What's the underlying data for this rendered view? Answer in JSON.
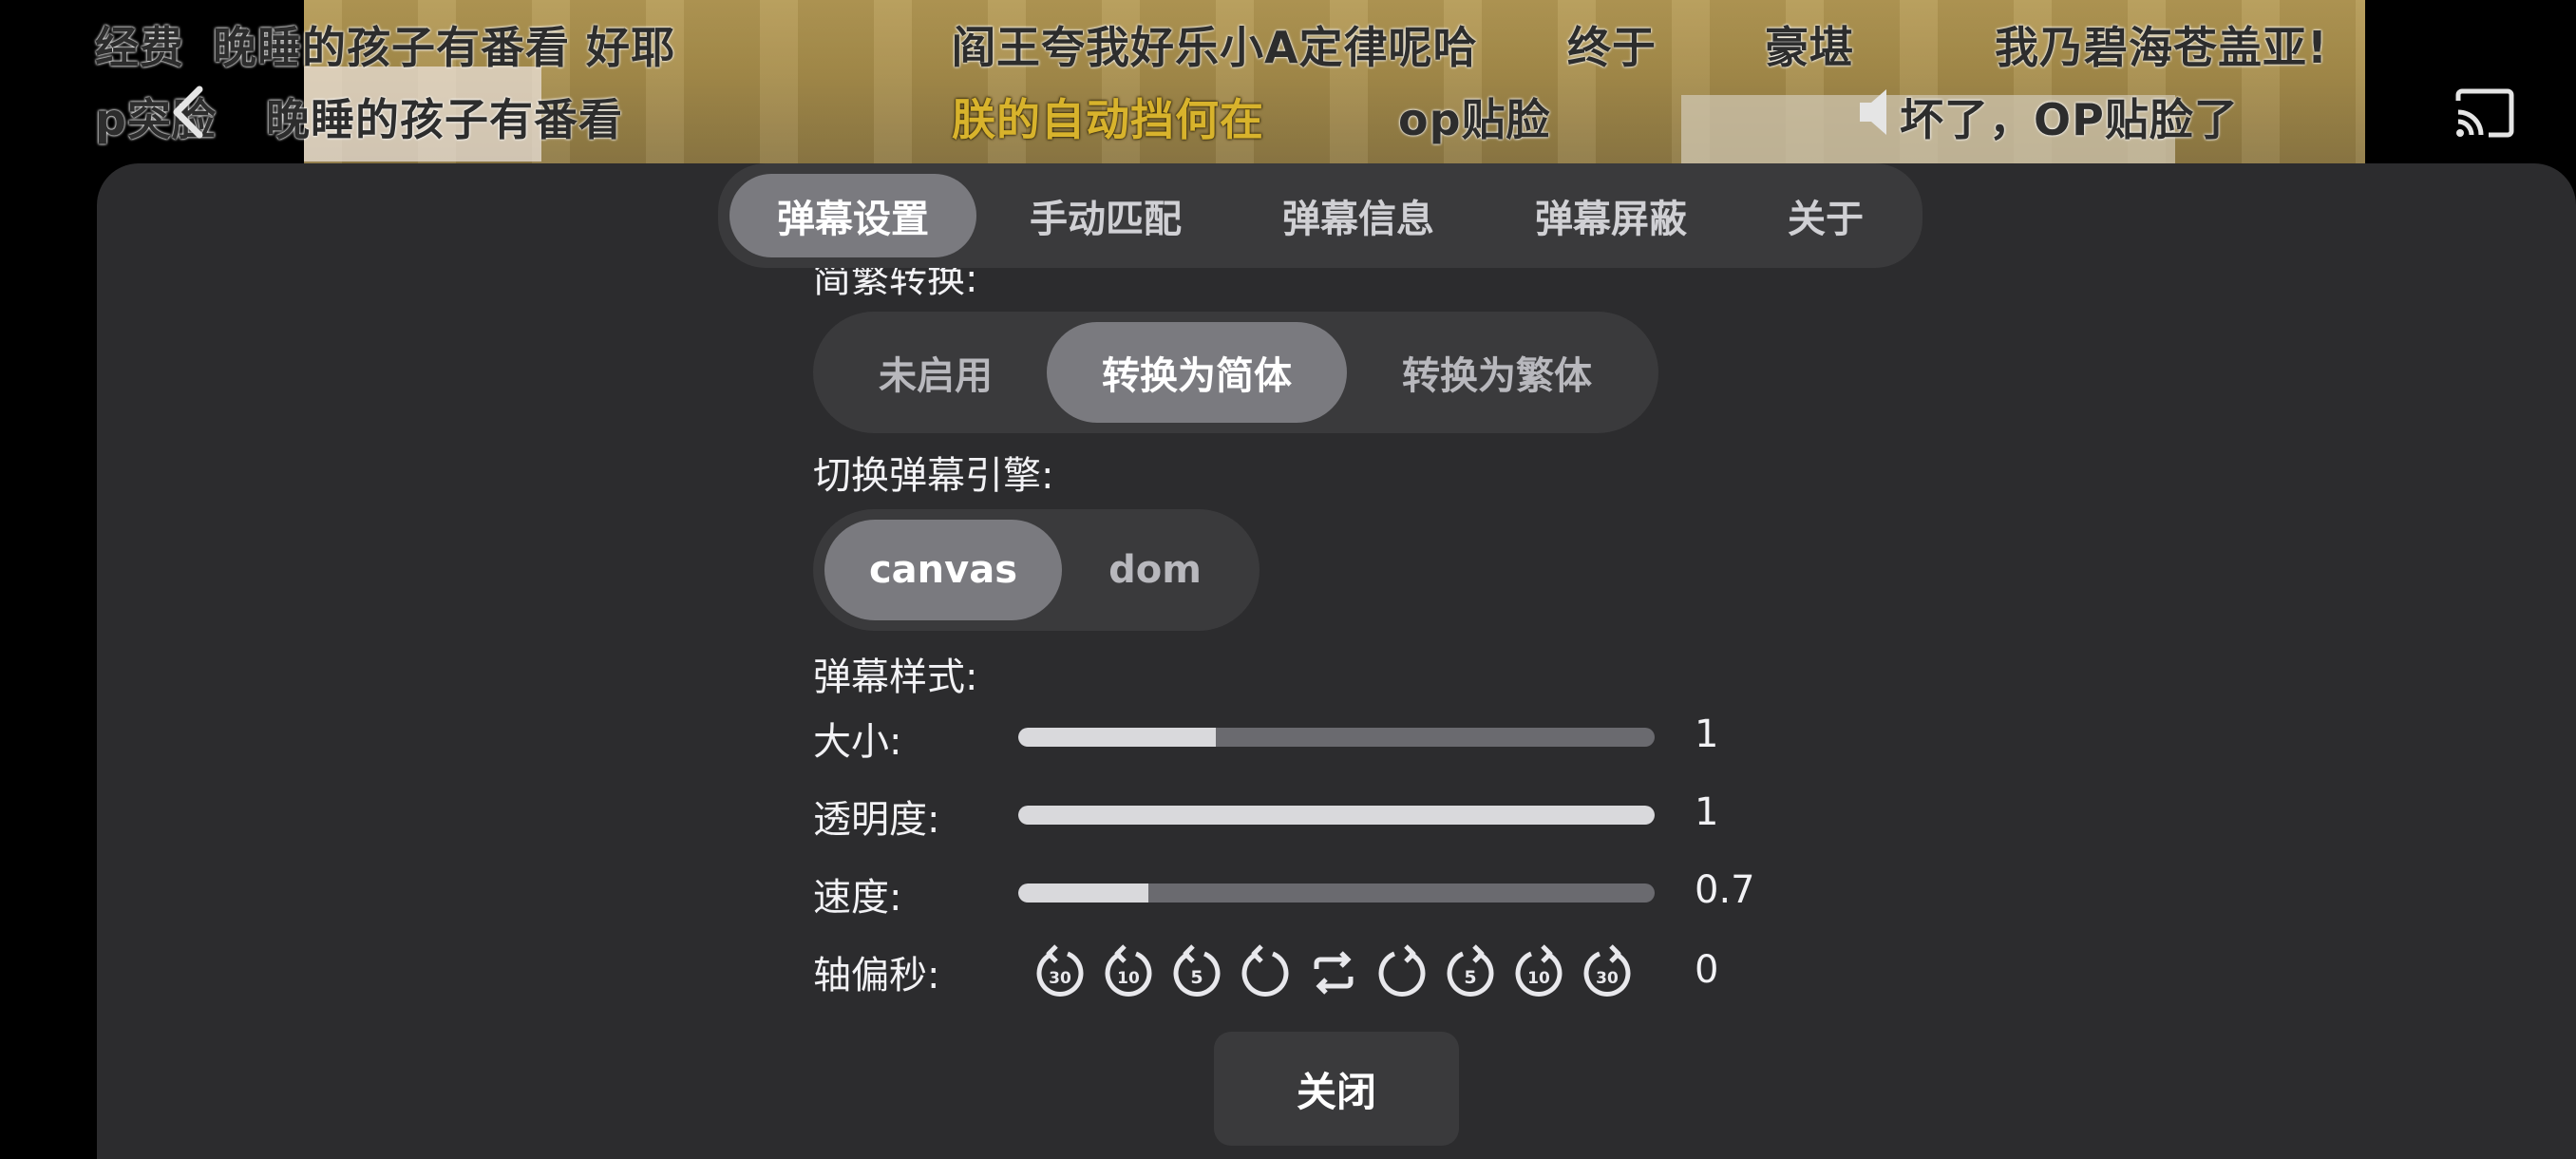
{
  "video": {
    "danmaku_row1": [
      "经费",
      "晚睡的孩子有番看 好耶",
      "阎王夸我好乐小A定律呢哈",
      "终于",
      "豪堪",
      "我乃碧海苍盖亚!"
    ],
    "danmaku_row2": [
      "p突脸",
      "晚睡的孩子有番看",
      "朕的自动挡何在",
      "op贴脸",
      "坏了，OP贴脸了"
    ]
  },
  "tabs": [
    {
      "label": "弹幕设置",
      "active": true
    },
    {
      "label": "手动匹配",
      "active": false
    },
    {
      "label": "弹幕信息",
      "active": false
    },
    {
      "label": "弹幕屏蔽",
      "active": false
    },
    {
      "label": "关于",
      "active": false
    }
  ],
  "settings": {
    "convert_label": "简繁转换:",
    "convert_options": [
      {
        "label": "未启用",
        "active": false
      },
      {
        "label": "转换为简体",
        "active": true
      },
      {
        "label": "转换为繁体",
        "active": false
      }
    ],
    "engine_label": "切换弹幕引擎:",
    "engine_options": [
      {
        "label": "canvas",
        "active": true
      },
      {
        "label": "dom",
        "active": false
      }
    ],
    "style_label": "弹幕样式:",
    "size": {
      "label": "大小:",
      "value_text": "1",
      "fill_fraction": 0.31
    },
    "opacity": {
      "label": "透明度:",
      "value_text": "1",
      "fill_fraction": 1.0
    },
    "speed": {
      "label": "速度:",
      "value_text": "0.7",
      "fill_fraction": 0.205
    },
    "offset": {
      "label": "轴偏秒:",
      "value_text": "0",
      "buttons": [
        {
          "icon": "rewind-30-icon",
          "num": "30",
          "dir": "back"
        },
        {
          "icon": "rewind-10-icon",
          "num": "10",
          "dir": "back"
        },
        {
          "icon": "rewind-5-icon",
          "num": "5",
          "dir": "back"
        },
        {
          "icon": "rewind-1-icon",
          "num": "",
          "dir": "back"
        },
        {
          "icon": "reset-icon",
          "num": "",
          "dir": "reset"
        },
        {
          "icon": "forward-1-icon",
          "num": "",
          "dir": "fwd"
        },
        {
          "icon": "forward-5-icon",
          "num": "5",
          "dir": "fwd"
        },
        {
          "icon": "forward-10-icon",
          "num": "10",
          "dir": "fwd"
        },
        {
          "icon": "forward-30-icon",
          "num": "30",
          "dir": "fwd"
        }
      ]
    }
  },
  "close_label": "关闭",
  "colors": {
    "panel_bg": "#2c2c2e",
    "segment_bg": "#3a3a3c",
    "active_pill": "#7a7a7f",
    "slider_fill": "#d9d9dc",
    "slider_track": "#6a6a6f",
    "danmaku_gold": "#d8b32c"
  }
}
